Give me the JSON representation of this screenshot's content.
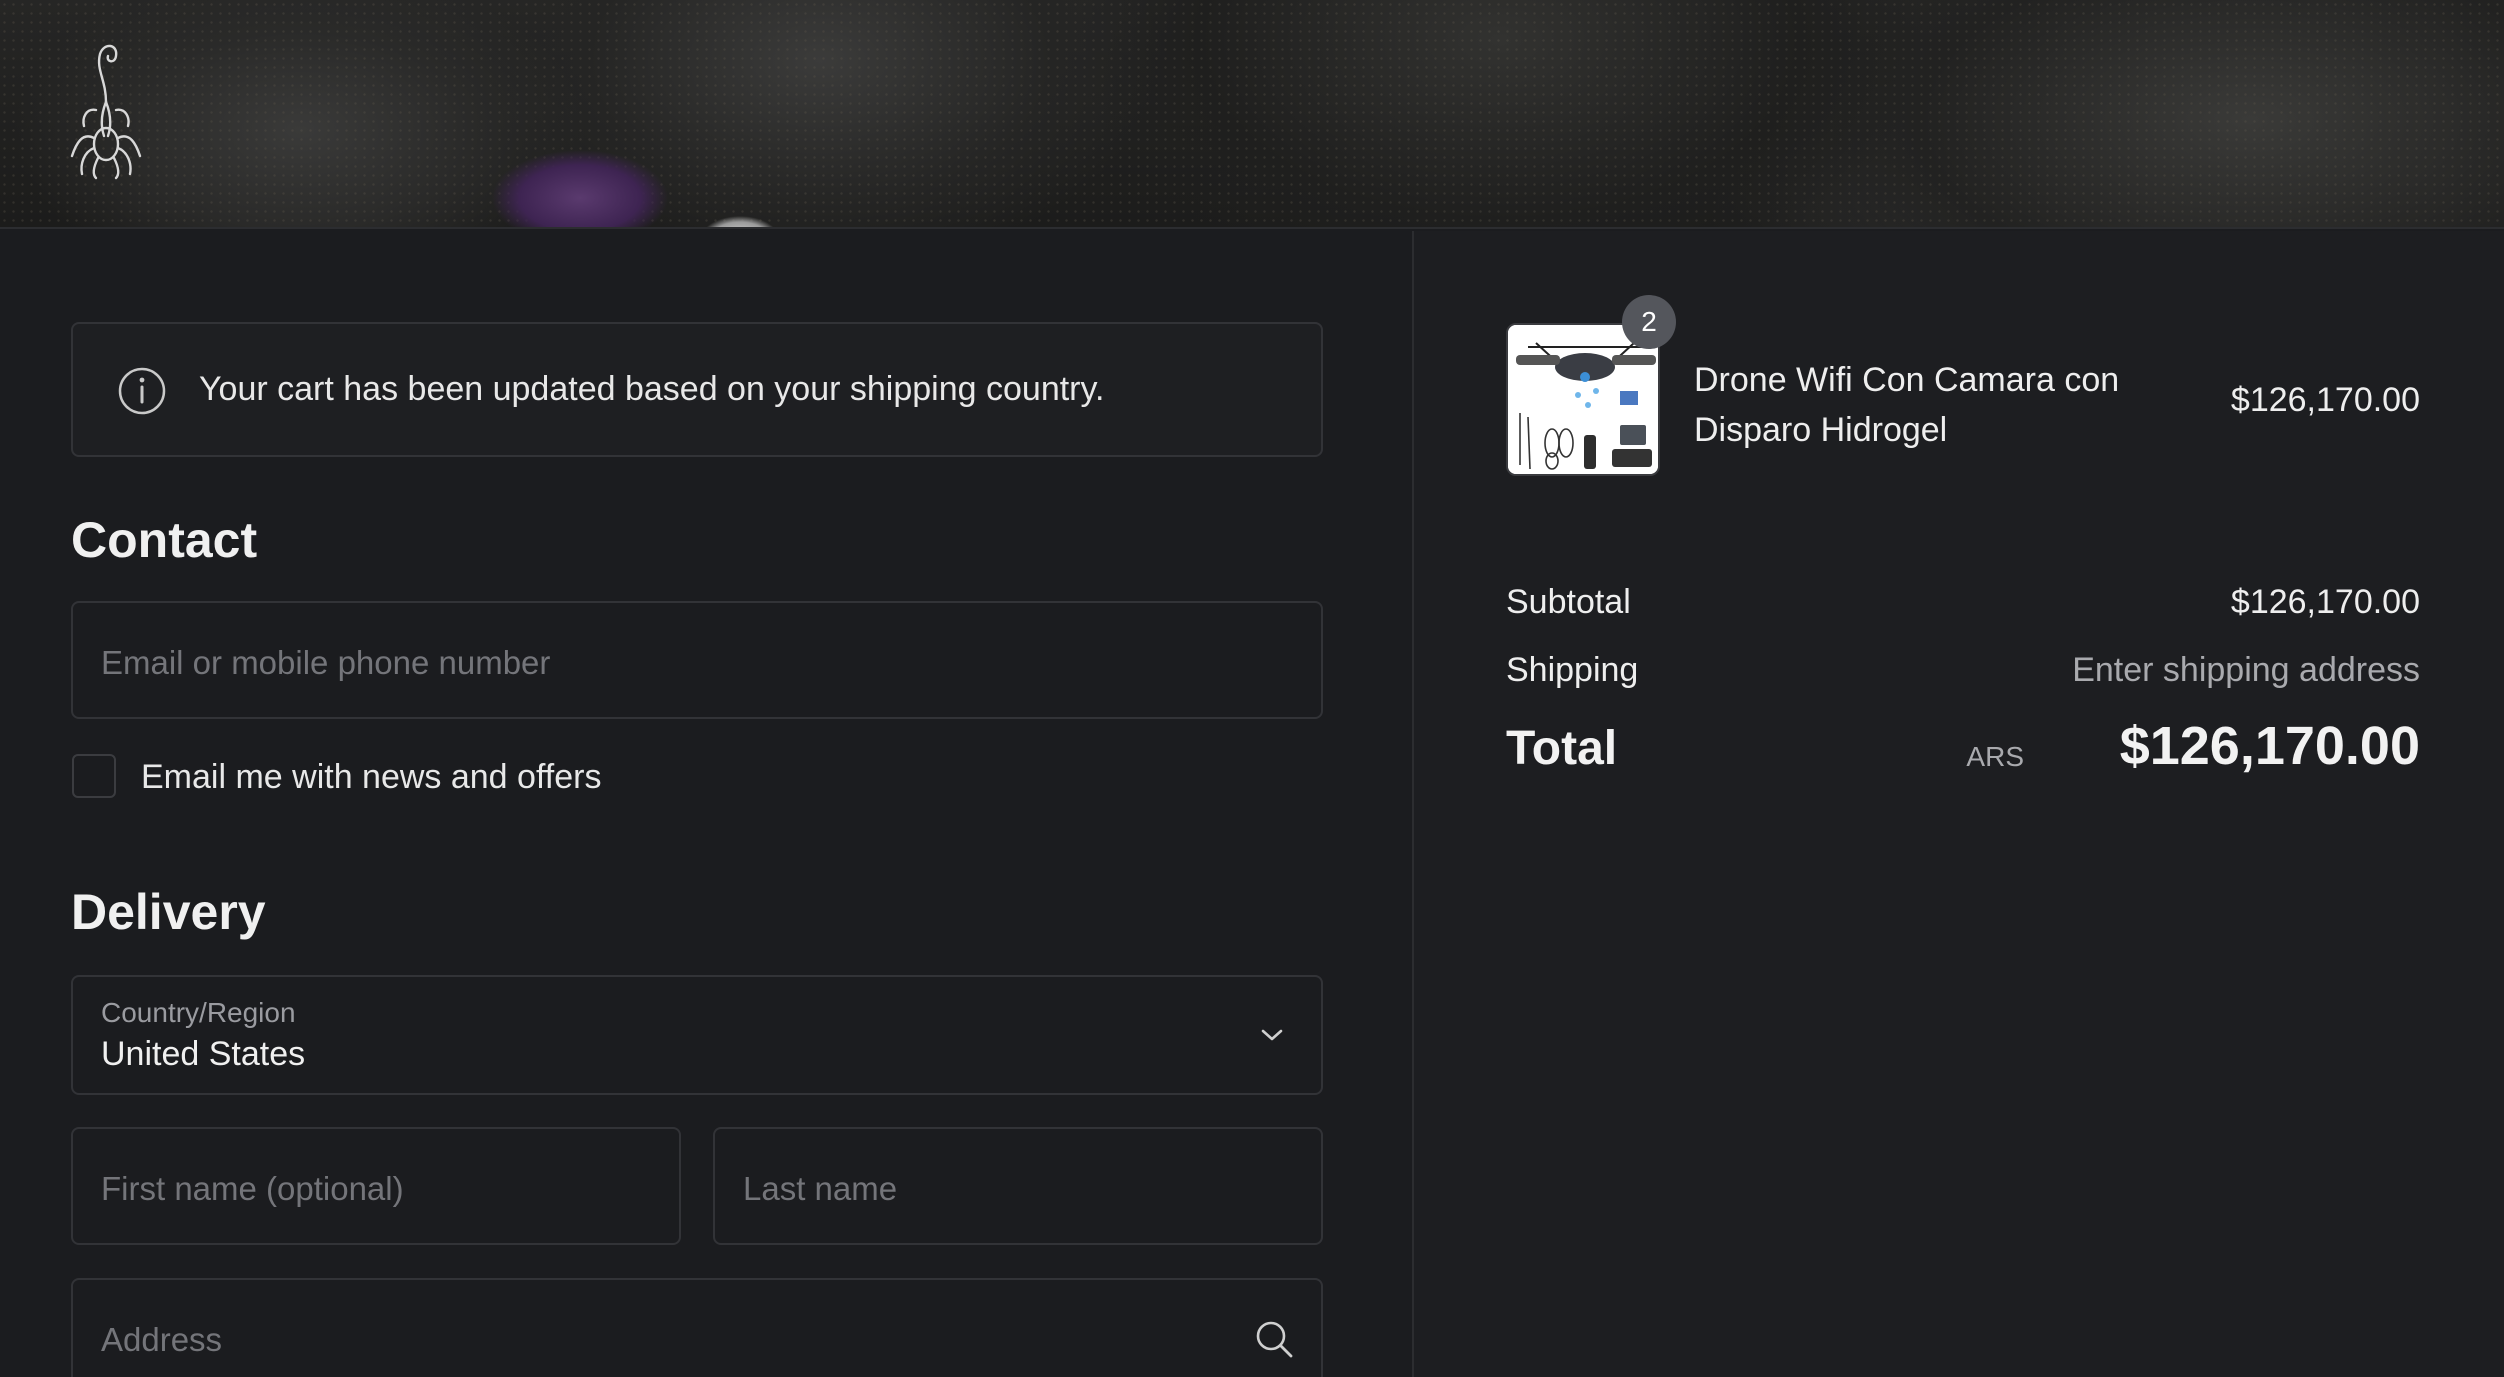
{
  "notice": {
    "icon": "info-icon",
    "text": "Your cart has been updated based on your shipping country."
  },
  "contact": {
    "title": "Contact",
    "email_placeholder": "Email or mobile phone number",
    "newsletter_label": "Email me with news and offers",
    "newsletter_checked": false
  },
  "delivery": {
    "title": "Delivery",
    "country_label": "Country/Region",
    "country_value": "United States",
    "first_name_placeholder": "First name (optional)",
    "last_name_placeholder": "Last name",
    "address_placeholder": "Address"
  },
  "order": {
    "item": {
      "name": "Drone Wifi Con Camara con Disparo Hidrogel",
      "quantity": "2",
      "price": "$126,170.00"
    },
    "subtotal_label": "Subtotal",
    "subtotal_value": "$126,170.00",
    "shipping_label": "Shipping",
    "shipping_value": "Enter shipping address",
    "total_label": "Total",
    "currency": "ARS",
    "total_value": "$126,170.00"
  },
  "colors": {
    "background": "#1b1c1f",
    "summary_background": "#1d1e21",
    "border": "#323337",
    "badge": "#54565c"
  }
}
